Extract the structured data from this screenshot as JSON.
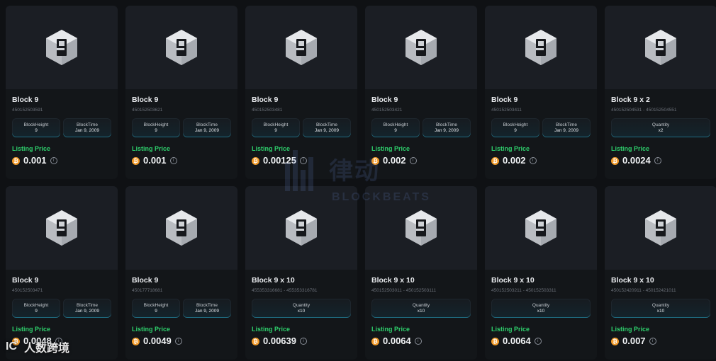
{
  "listing": {
    "price_label": "Listing Price",
    "cards": [
      {
        "name": "Block 9",
        "sub": "450152503591",
        "attrs": [
          {
            "k": "BlockHeight",
            "v": "9"
          },
          {
            "k": "BlockTime",
            "v": "Jan 9, 2009"
          }
        ],
        "price": "0.001"
      },
      {
        "name": "Block 9",
        "sub": "450152503621",
        "attrs": [
          {
            "k": "BlockHeight",
            "v": "9"
          },
          {
            "k": "BlockTime",
            "v": "Jan 9, 2009"
          }
        ],
        "price": "0.001"
      },
      {
        "name": "Block 9",
        "sub": "450152503481",
        "attrs": [
          {
            "k": "BlockHeight",
            "v": "9"
          },
          {
            "k": "BlockTime",
            "v": "Jan 9, 2009"
          }
        ],
        "price": "0.00125"
      },
      {
        "name": "Block 9",
        "sub": "450152503421",
        "attrs": [
          {
            "k": "BlockHeight",
            "v": "9"
          },
          {
            "k": "BlockTime",
            "v": "Jan 9, 2009"
          }
        ],
        "price": "0.002"
      },
      {
        "name": "Block 9",
        "sub": "450152503411",
        "attrs": [
          {
            "k": "BlockHeight",
            "v": "9"
          },
          {
            "k": "BlockTime",
            "v": "Jan 9, 2009"
          }
        ],
        "price": "0.002"
      },
      {
        "name": "Block 9 x 2",
        "sub": "450152504531 - 450152504551",
        "attrs": [
          {
            "k": "Quantity",
            "v": "x2"
          }
        ],
        "price": "0.0024"
      },
      {
        "name": "Block 9",
        "sub": "450152503471",
        "attrs": [
          {
            "k": "BlockHeight",
            "v": "9"
          },
          {
            "k": "BlockTime",
            "v": "Jan 9, 2009"
          }
        ],
        "price": "0.0048"
      },
      {
        "name": "Block 9",
        "sub": "450177718681",
        "attrs": [
          {
            "k": "BlockHeight",
            "v": "9"
          },
          {
            "k": "BlockTime",
            "v": "Jan 9, 2009"
          }
        ],
        "price": "0.0049"
      },
      {
        "name": "Block 9 x 10",
        "sub": "455353316681 - 455353316781",
        "attrs": [
          {
            "k": "Quantity",
            "v": "x10"
          }
        ],
        "price": "0.00639"
      },
      {
        "name": "Block 9 x 10",
        "sub": "450152503011 - 450152503111",
        "attrs": [
          {
            "k": "Quantity",
            "v": "x10"
          }
        ],
        "price": "0.0064"
      },
      {
        "name": "Block 9 x 10",
        "sub": "450152503211 - 450152503311",
        "attrs": [
          {
            "k": "Quantity",
            "v": "x10"
          }
        ],
        "price": "0.0064"
      },
      {
        "name": "Block 9 x 10",
        "sub": "450152420911 - 450152421011",
        "attrs": [
          {
            "k": "Quantity",
            "v": "x10"
          }
        ],
        "price": "0.007"
      }
    ]
  },
  "watermark": {
    "cn": "律动",
    "en": "BLOCKBEATS"
  },
  "corner_mark": {
    "logo": "IC",
    "text": "人数跨境"
  },
  "colors": {
    "accent_green": "#2ecf6c",
    "btc_orange": "#f29a28",
    "attr_border": "#1f6b80"
  },
  "icons": {
    "nft_icon": "hexagon-cube-9-icon",
    "currency_icon": "bitcoin-icon",
    "info_icon": "info-circle-icon"
  }
}
